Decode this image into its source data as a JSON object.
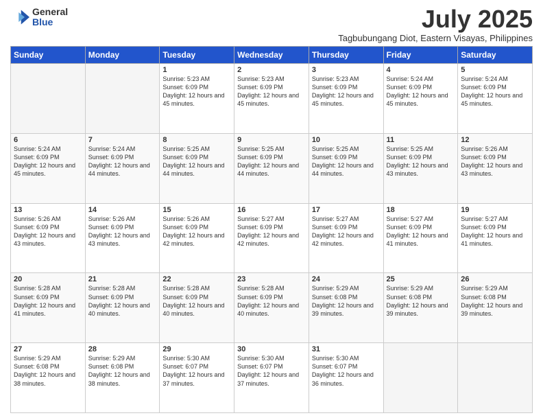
{
  "logo": {
    "general": "General",
    "blue": "Blue"
  },
  "title": "July 2025",
  "subtitle": "Tagbubungang Diot, Eastern Visayas, Philippines",
  "days_of_week": [
    "Sunday",
    "Monday",
    "Tuesday",
    "Wednesday",
    "Thursday",
    "Friday",
    "Saturday"
  ],
  "weeks": [
    [
      {
        "day": "",
        "info": ""
      },
      {
        "day": "",
        "info": ""
      },
      {
        "day": "1",
        "info": "Sunrise: 5:23 AM\nSunset: 6:09 PM\nDaylight: 12 hours and 45 minutes."
      },
      {
        "day": "2",
        "info": "Sunrise: 5:23 AM\nSunset: 6:09 PM\nDaylight: 12 hours and 45 minutes."
      },
      {
        "day": "3",
        "info": "Sunrise: 5:23 AM\nSunset: 6:09 PM\nDaylight: 12 hours and 45 minutes."
      },
      {
        "day": "4",
        "info": "Sunrise: 5:24 AM\nSunset: 6:09 PM\nDaylight: 12 hours and 45 minutes."
      },
      {
        "day": "5",
        "info": "Sunrise: 5:24 AM\nSunset: 6:09 PM\nDaylight: 12 hours and 45 minutes."
      }
    ],
    [
      {
        "day": "6",
        "info": "Sunrise: 5:24 AM\nSunset: 6:09 PM\nDaylight: 12 hours and 45 minutes."
      },
      {
        "day": "7",
        "info": "Sunrise: 5:24 AM\nSunset: 6:09 PM\nDaylight: 12 hours and 44 minutes."
      },
      {
        "day": "8",
        "info": "Sunrise: 5:25 AM\nSunset: 6:09 PM\nDaylight: 12 hours and 44 minutes."
      },
      {
        "day": "9",
        "info": "Sunrise: 5:25 AM\nSunset: 6:09 PM\nDaylight: 12 hours and 44 minutes."
      },
      {
        "day": "10",
        "info": "Sunrise: 5:25 AM\nSunset: 6:09 PM\nDaylight: 12 hours and 44 minutes."
      },
      {
        "day": "11",
        "info": "Sunrise: 5:25 AM\nSunset: 6:09 PM\nDaylight: 12 hours and 43 minutes."
      },
      {
        "day": "12",
        "info": "Sunrise: 5:26 AM\nSunset: 6:09 PM\nDaylight: 12 hours and 43 minutes."
      }
    ],
    [
      {
        "day": "13",
        "info": "Sunrise: 5:26 AM\nSunset: 6:09 PM\nDaylight: 12 hours and 43 minutes."
      },
      {
        "day": "14",
        "info": "Sunrise: 5:26 AM\nSunset: 6:09 PM\nDaylight: 12 hours and 43 minutes."
      },
      {
        "day": "15",
        "info": "Sunrise: 5:26 AM\nSunset: 6:09 PM\nDaylight: 12 hours and 42 minutes."
      },
      {
        "day": "16",
        "info": "Sunrise: 5:27 AM\nSunset: 6:09 PM\nDaylight: 12 hours and 42 minutes."
      },
      {
        "day": "17",
        "info": "Sunrise: 5:27 AM\nSunset: 6:09 PM\nDaylight: 12 hours and 42 minutes."
      },
      {
        "day": "18",
        "info": "Sunrise: 5:27 AM\nSunset: 6:09 PM\nDaylight: 12 hours and 41 minutes."
      },
      {
        "day": "19",
        "info": "Sunrise: 5:27 AM\nSunset: 6:09 PM\nDaylight: 12 hours and 41 minutes."
      }
    ],
    [
      {
        "day": "20",
        "info": "Sunrise: 5:28 AM\nSunset: 6:09 PM\nDaylight: 12 hours and 41 minutes."
      },
      {
        "day": "21",
        "info": "Sunrise: 5:28 AM\nSunset: 6:09 PM\nDaylight: 12 hours and 40 minutes."
      },
      {
        "day": "22",
        "info": "Sunrise: 5:28 AM\nSunset: 6:09 PM\nDaylight: 12 hours and 40 minutes."
      },
      {
        "day": "23",
        "info": "Sunrise: 5:28 AM\nSunset: 6:09 PM\nDaylight: 12 hours and 40 minutes."
      },
      {
        "day": "24",
        "info": "Sunrise: 5:29 AM\nSunset: 6:08 PM\nDaylight: 12 hours and 39 minutes."
      },
      {
        "day": "25",
        "info": "Sunrise: 5:29 AM\nSunset: 6:08 PM\nDaylight: 12 hours and 39 minutes."
      },
      {
        "day": "26",
        "info": "Sunrise: 5:29 AM\nSunset: 6:08 PM\nDaylight: 12 hours and 39 minutes."
      }
    ],
    [
      {
        "day": "27",
        "info": "Sunrise: 5:29 AM\nSunset: 6:08 PM\nDaylight: 12 hours and 38 minutes."
      },
      {
        "day": "28",
        "info": "Sunrise: 5:29 AM\nSunset: 6:08 PM\nDaylight: 12 hours and 38 minutes."
      },
      {
        "day": "29",
        "info": "Sunrise: 5:30 AM\nSunset: 6:07 PM\nDaylight: 12 hours and 37 minutes."
      },
      {
        "day": "30",
        "info": "Sunrise: 5:30 AM\nSunset: 6:07 PM\nDaylight: 12 hours and 37 minutes."
      },
      {
        "day": "31",
        "info": "Sunrise: 5:30 AM\nSunset: 6:07 PM\nDaylight: 12 hours and 36 minutes."
      },
      {
        "day": "",
        "info": ""
      },
      {
        "day": "",
        "info": ""
      }
    ]
  ]
}
